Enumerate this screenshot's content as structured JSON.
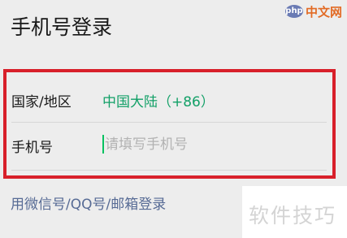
{
  "header": {
    "title": "手机号登录"
  },
  "watermark": {
    "logo_text": "php",
    "site_text": "中文网"
  },
  "form": {
    "region": {
      "label": "国家/地区",
      "value": "中国大陆（+86）"
    },
    "phone": {
      "label": "手机号",
      "placeholder": "请填写手机号",
      "value": ""
    }
  },
  "alt_login": {
    "label": "用微信号/QQ号/邮箱登录"
  },
  "footer_watermark": {
    "text": "软件技巧"
  },
  "colors": {
    "accent_green": "#12a067",
    "link_blue": "#576b95",
    "highlight_border": "#d8202a",
    "background": "#ededed"
  }
}
